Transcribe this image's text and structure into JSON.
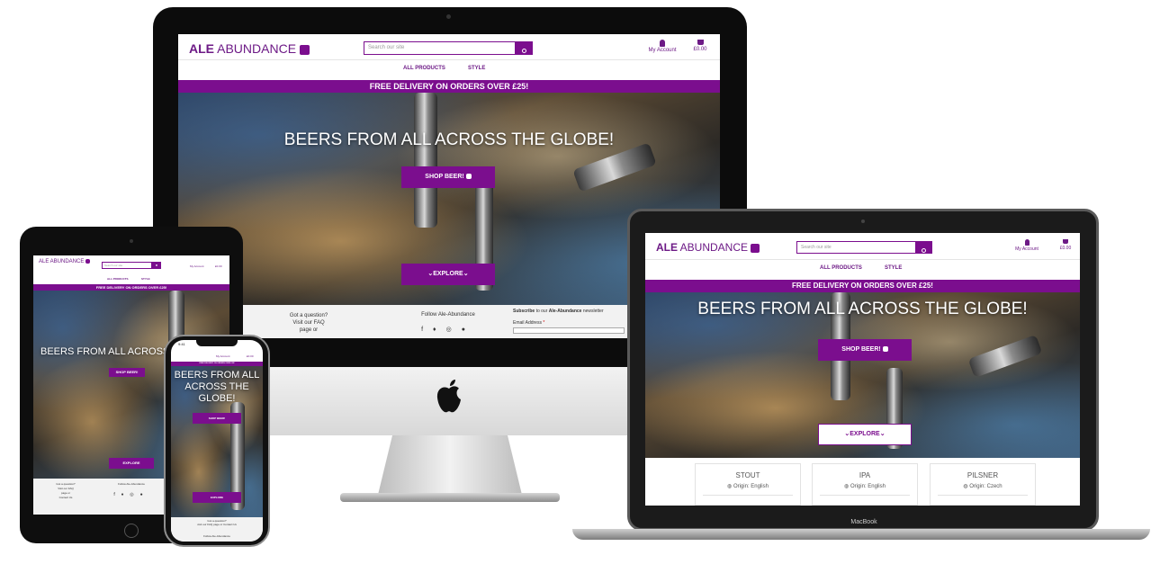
{
  "brand": {
    "ale": "ALE",
    "abundance": "ABUNDANCE",
    "tablet_name": "ALE ABUNDANCE"
  },
  "header": {
    "search_placeholder": "Search our site",
    "account_label": "My Account",
    "cart_total": "£0.00"
  },
  "nav": {
    "all_products": "ALL PRODUCTS",
    "style": "STYLE"
  },
  "banner": {
    "text": "FREE DELIVERY ON ORDERS OVER £25!"
  },
  "hero": {
    "title": "BEERS FROM ALL ACROSS THE GLOBE!",
    "title_tablet": "BEERS FROM ALL ACROSS",
    "title_phone": "BEERS FROM ALL ACROSS THE GLOBE!",
    "shop_button": "SHOP BEER!",
    "explore_button": "EXPLORE"
  },
  "footer": {
    "question_line1": "Got a question?",
    "question_line2": "Visit our FAQ",
    "question_line3": "page or",
    "contact": "Contact Us",
    "follow": "Follow Ale-Abundance",
    "subscribe_prefix": "Subscribe",
    "subscribe_mid": " to our ",
    "subscribe_brand": "Ale-Abundance",
    "subscribe_suffix": " newsletter",
    "email_label": "Email Address",
    "email_required": "*",
    "phone_question": "Got a question?",
    "phone_faq": "visit our FAQ page or Contact Us",
    "phone_follow": "Follow Ale-Abundance"
  },
  "social_icons": [
    "facebook-icon",
    "twitter-icon",
    "instagram-icon",
    "github-icon"
  ],
  "products": [
    {
      "name": "STOUT",
      "origin": "Origin: English"
    },
    {
      "name": "IPA",
      "origin": "Origin: English"
    },
    {
      "name": "PILSNER",
      "origin": "Origin: Czech"
    }
  ],
  "phone_status": {
    "time": "9:41"
  },
  "laptop_label": "MacBook",
  "colors": {
    "brand_purple": "#7b0e8e",
    "brand_text": "#6d1a86"
  }
}
